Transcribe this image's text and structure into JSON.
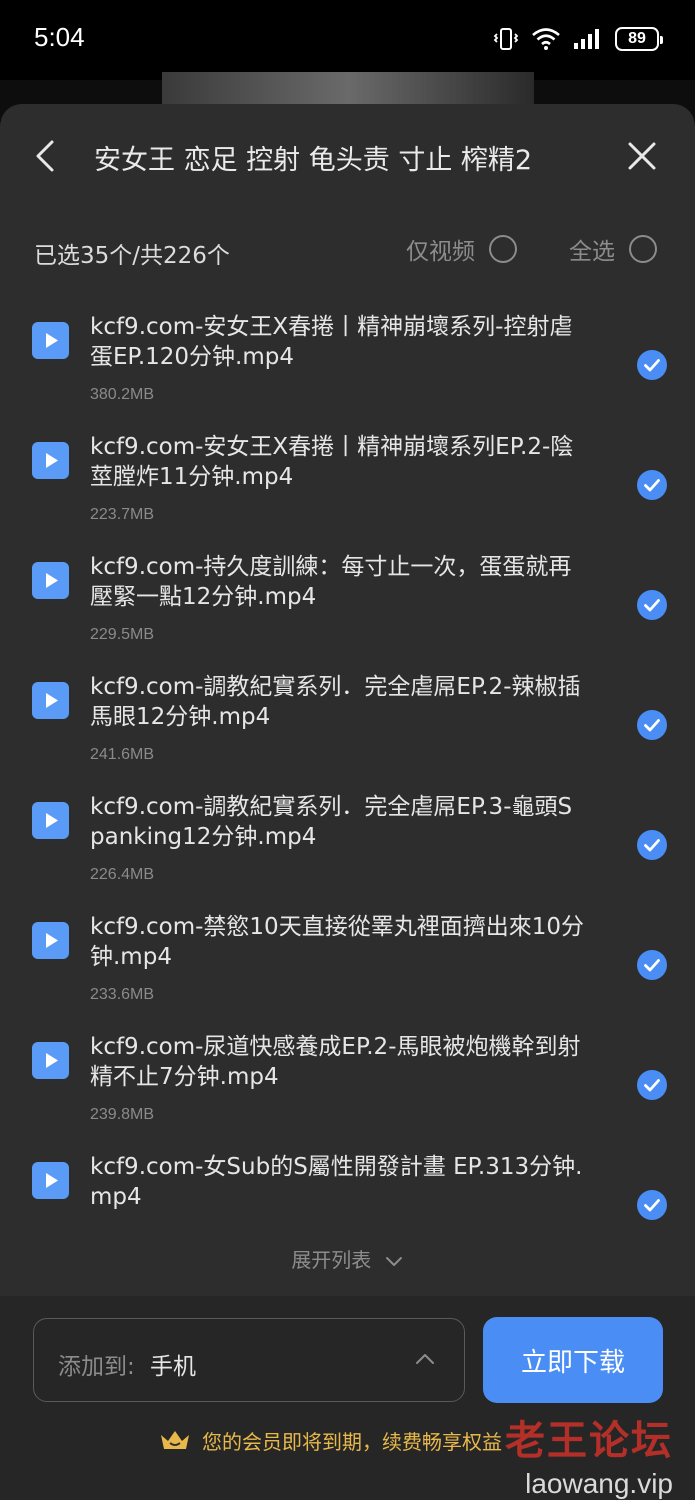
{
  "status": {
    "time": "5:04",
    "battery": "89"
  },
  "header": {
    "title": "安女王 恋足 控射 龟头责 寸止 榨精2"
  },
  "selection": {
    "count": "已选35个/共226个",
    "video_only_label": "仅视频",
    "select_all_label": "全选"
  },
  "files": [
    {
      "name": "kcf9.com-安女王X春捲丨精神崩壞系列-控射虐蛋EP.120分钟.mp4",
      "size": "380.2MB",
      "selected": true
    },
    {
      "name": "kcf9.com-安女王X春捲丨精神崩壞系列EP.2-陰莖膛炸11分钟.mp4",
      "size": "223.7MB",
      "selected": true
    },
    {
      "name": "kcf9.com-持久度訓練：每寸止一次，蛋蛋就再壓緊一點12分钟.mp4",
      "size": "229.5MB",
      "selected": true
    },
    {
      "name": "kcf9.com-調教紀實系列．完全虐屌EP.2-辣椒插馬眼12分钟.mp4",
      "size": "241.6MB",
      "selected": true
    },
    {
      "name": "kcf9.com-調教紀實系列．完全虐屌EP.3-龜頭Spanking12分钟.mp4",
      "size": "226.4MB",
      "selected": true
    },
    {
      "name": "kcf9.com-禁慾10天直接從睪丸裡面擠出來10分钟.mp4",
      "size": "233.6MB",
      "selected": true
    },
    {
      "name": "kcf9.com-尿道快感養成EP.2-馬眼被炮機幹到射精不止7分钟.mp4",
      "size": "239.8MB",
      "selected": true
    },
    {
      "name": "kcf9.com-女Sub的S屬性開發計畫 EP.313分钟.mp4",
      "size": "",
      "selected": true
    }
  ],
  "expand_label": "展开列表",
  "footer": {
    "target_label": "添加到:",
    "target_value": "手机",
    "download_label": "立即下载",
    "vip_notice": "您的会员即将到期，续费畅享权益"
  },
  "watermark": {
    "title": "老王论坛",
    "site": "laowang.vip"
  },
  "colors": {
    "accent": "#4a8ef5",
    "sheet_bg": "#2d2d2d",
    "vip_gold": "#e8b94a"
  }
}
